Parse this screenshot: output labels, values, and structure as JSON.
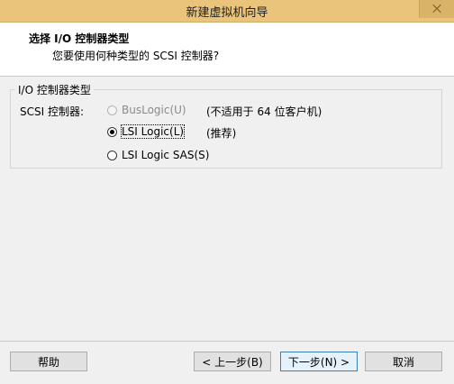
{
  "window": {
    "title": "新建虚拟机向导"
  },
  "header": {
    "title": "选择 I/O 控制器类型",
    "subtitle": "您要使用何种类型的 SCSI 控制器?"
  },
  "group": {
    "legend": "I/O 控制器类型",
    "label": "SCSI 控制器:",
    "options": [
      {
        "label": "BusLogic(U)",
        "note": "(不适用于 64 位客户机)",
        "selected": false,
        "enabled": false
      },
      {
        "label": "LSI Logic(L)",
        "note": "(推荐)",
        "selected": true,
        "enabled": true
      },
      {
        "label": "LSI Logic SAS(S)",
        "note": "",
        "selected": false,
        "enabled": true
      }
    ]
  },
  "buttons": {
    "help": "帮助",
    "back": "< 上一步(B)",
    "next": "下一步(N) >",
    "cancel": "取消"
  }
}
